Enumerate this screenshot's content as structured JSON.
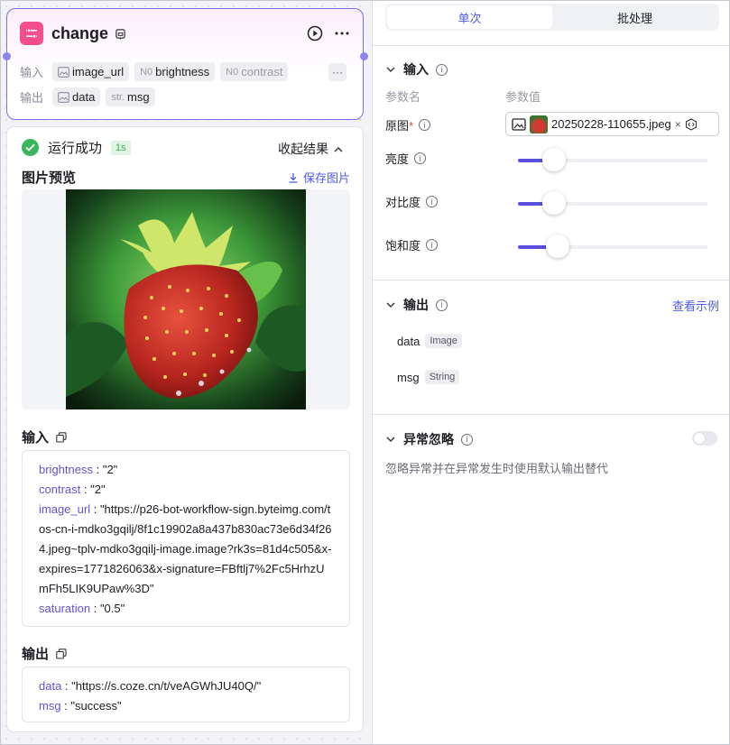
{
  "node": {
    "title": "change",
    "input_label": "输入",
    "output_label": "输出",
    "inputs": [
      {
        "prefix": "",
        "name": "image_url",
        "type_icon": "image-icon"
      },
      {
        "prefix": "N0",
        "name": "brightness",
        "type_icon": "number-icon"
      },
      {
        "prefix": "N0",
        "name": "contrast",
        "type_icon": "number-icon"
      }
    ],
    "outputs": [
      {
        "prefix": "",
        "name": "data",
        "type_icon": "image-icon"
      },
      {
        "prefix": "str.",
        "name": "msg",
        "type_icon": "string-icon"
      }
    ],
    "accent_color": "#f34f8e",
    "border_color": "#7c6ee8"
  },
  "result": {
    "status_text": "运行成功",
    "time": "1s",
    "collapse_label": "收起结果",
    "preview_title": "图片预览",
    "save_label": "保存图片",
    "input_title": "输入",
    "input_json": [
      {
        "key": "brightness",
        "value": "\"2\""
      },
      {
        "key": "contrast",
        "value": "\"2\""
      },
      {
        "key": "image_url",
        "value": "\"https://p26-bot-workflow-sign.byteimg.com/tos-cn-i-mdko3gqilj/8f1c19902a8a437b830ac73e6d34f264.jpeg~tplv-mdko3gqilj-image.image?rk3s=81d4c505&x-expires=1771826063&x-signature=FBftlj7%2Fc5HrhzUmFh5LIK9UPaw%3D\""
      },
      {
        "key": "saturation",
        "value": "\"0.5\""
      }
    ],
    "output_title": "输出",
    "output_json": [
      {
        "key": "data",
        "value": "\"https://s.coze.cn/t/veAGWhJU40Q/\""
      },
      {
        "key": "msg",
        "value": "\"success\""
      }
    ],
    "success_color": "#3ab55c"
  },
  "panel": {
    "tabs": [
      "单次",
      "批处理"
    ],
    "active_tab": 0,
    "input_section": "输入",
    "col_name": "参数名",
    "col_value": "参数值",
    "params": {
      "image_label": "原图",
      "file_name": "20250228-110655.jpeg",
      "brightness_label": "亮度",
      "contrast_label": "对比度",
      "saturation_label": "饱和度"
    },
    "sliders": {
      "brightness": 0.19,
      "contrast": 0.19,
      "saturation": 0.21
    },
    "output_section": "输出",
    "view_example": "查看示例",
    "outputs": [
      {
        "name": "data",
        "type": "Image"
      },
      {
        "name": "msg",
        "type": "String"
      }
    ],
    "exception_section": "异常忽略",
    "exception_desc": "忽略异常并在异常发生时使用默认输出替代",
    "accent_color": "#4e5bf0"
  }
}
